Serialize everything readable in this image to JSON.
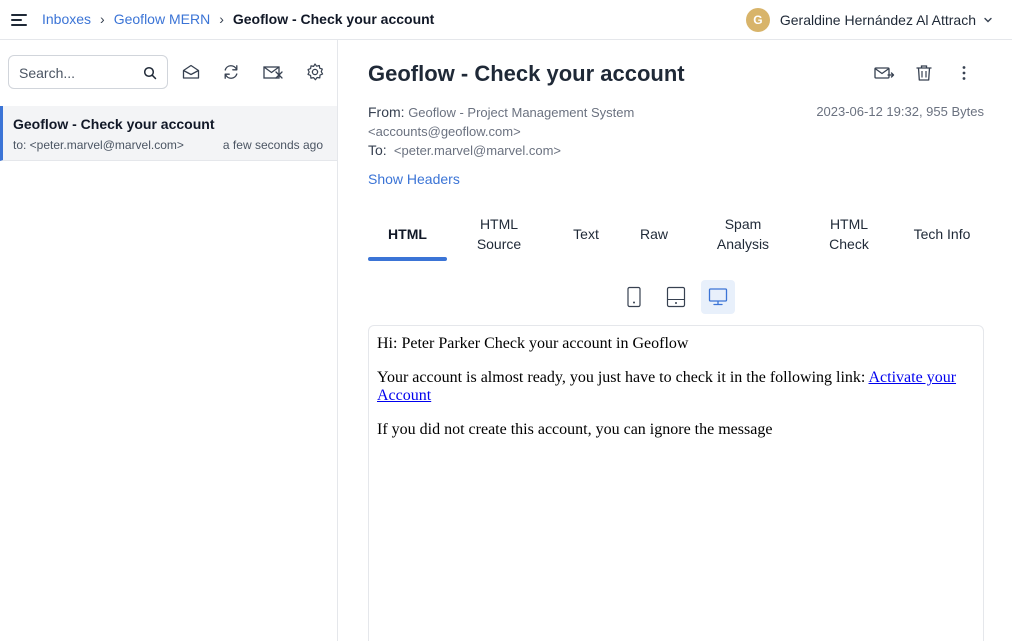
{
  "colors": {
    "accent": "#3b74d6",
    "avatar": "#d8b46a",
    "active_bg": "#f3f4f6"
  },
  "breadcrumb": {
    "items": [
      "Inboxes",
      "Geoflow MERN"
    ],
    "separator": "›",
    "current": "Geoflow - Check your account"
  },
  "user": {
    "initial": "G",
    "name": "Geraldine Hernández Al Attrach"
  },
  "sidebar": {
    "search": {
      "placeholder": "Search...",
      "value": ""
    },
    "tools": [
      "mark-read-icon",
      "refresh-icon",
      "clear-inbox-icon",
      "settings-icon"
    ],
    "messages": [
      {
        "subject": "Geoflow - Check your account",
        "to": "to: <peter.marvel@marvel.com>",
        "time": "a few seconds ago"
      }
    ]
  },
  "message": {
    "subject": "Geoflow - Check your account",
    "from_label": "From:",
    "from_name": "Geoflow - Project Management System",
    "from_email": "<accounts@geoflow.com>",
    "to_label": "To:",
    "to": "<peter.marvel@marvel.com>",
    "date_size": "2023-06-12 19:32, 955 Bytes",
    "show_headers": "Show Headers",
    "actions": [
      "forward-icon",
      "trash-icon",
      "more-icon"
    ]
  },
  "tabs": [
    {
      "label": "HTML",
      "active": true
    },
    {
      "label": "HTML Source"
    },
    {
      "label": "Text"
    },
    {
      "label": "Raw"
    },
    {
      "label": "Spam Analysis"
    },
    {
      "label": "HTML Check"
    },
    {
      "label": "Tech Info"
    }
  ],
  "device_views": [
    "mobile-icon",
    "tablet-icon",
    "desktop-icon"
  ],
  "device_selected": "desktop-icon",
  "body": {
    "greeting": "Hi: Peter Parker Check your account in Geoflow",
    "line2": "Your account is almost ready, you just have to check it in the following link:",
    "link": "Activate your Account",
    "line3": "If you did not create this account, you can ignore the message"
  }
}
